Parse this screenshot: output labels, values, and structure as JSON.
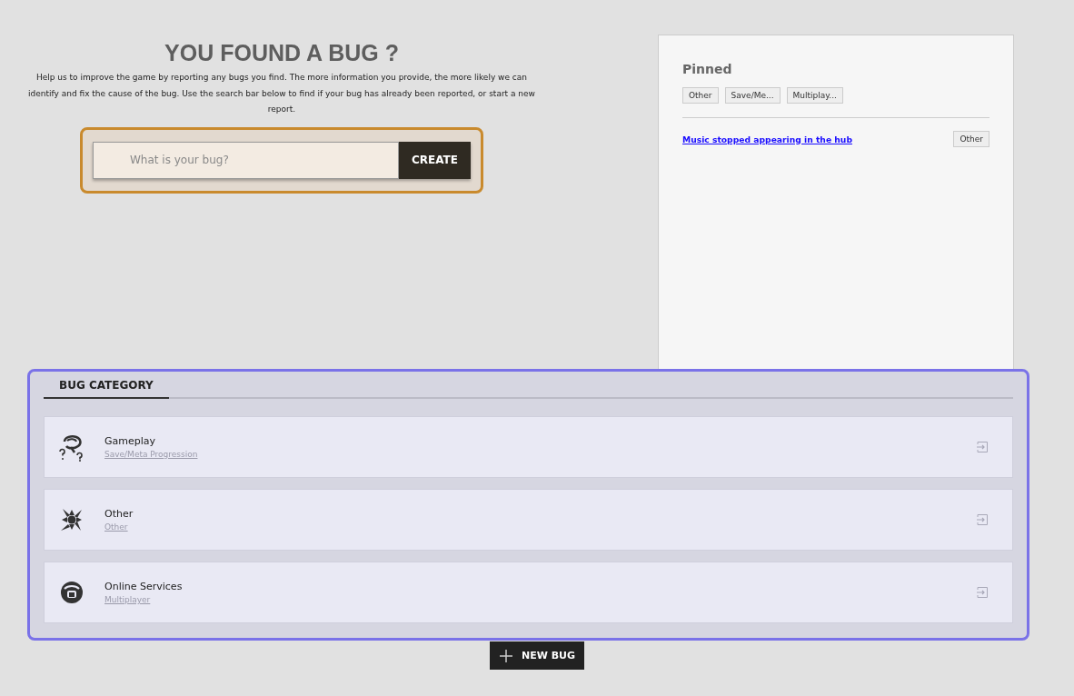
{
  "header": {
    "title": "YOU FOUND A BUG ?",
    "description": "Help us to improve the game by reporting any bugs you find. The more information you provide, the more likely we can identify and fix the cause of the bug. Use the search bar below to find if your bug has already been reported, or start a new report."
  },
  "search": {
    "placeholder": "What is your bug?",
    "button": "CREATE"
  },
  "pinned": {
    "title": "Pinned",
    "filters": [
      "Other",
      "Save/Me...",
      "Multiplay..."
    ],
    "items": [
      {
        "title": "Music stopped appearing in the hub",
        "tag": "Other"
      }
    ]
  },
  "category_tabs": [
    {
      "label": "BUG CATEGORY",
      "selected": true
    }
  ],
  "categories": [
    {
      "kind": "gameplay",
      "name": "Gameplay",
      "subcategory": "Save/Meta Progression"
    },
    {
      "kind": "other",
      "name": "Other",
      "subcategory": "Other"
    },
    {
      "kind": "online",
      "name": "Online Services",
      "subcategory": "Multiplayer"
    }
  ],
  "new_bug_button": "NEW BUG"
}
